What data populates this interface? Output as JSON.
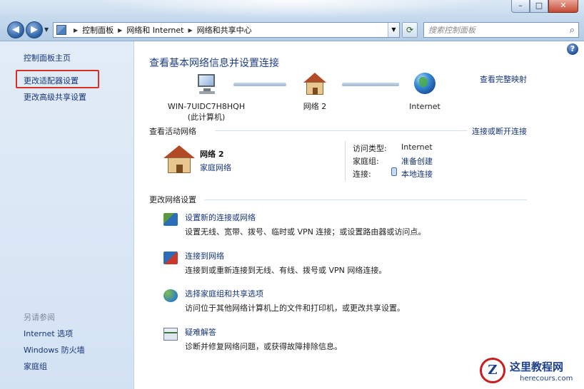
{
  "window": {
    "minimize": "–",
    "maximize": "□",
    "close": "✕"
  },
  "address": {
    "crumbs": [
      "控制面板",
      "网络和 Internet",
      "网络和共享中心"
    ]
  },
  "search": {
    "placeholder": "搜索控制面板"
  },
  "sidebar": {
    "home": "控制面板主页",
    "adapter": "更改适配器设置",
    "advanced": "更改高级共享设置",
    "see_also_header": "另请参阅",
    "see_also": [
      "Internet 选项",
      "Windows 防火墙",
      "家庭组"
    ]
  },
  "main": {
    "title": "查看基本网络信息并设置连接",
    "view_full_map": "查看完整映射",
    "map": {
      "pc_name": "WIN-7UIDC7H8HQH",
      "pc_sub": "(此计算机)",
      "network": "网络  2",
      "internet": "Internet"
    },
    "active_header": "查看活动网络",
    "connect_disconnect": "连接或断开连接",
    "active_network": {
      "name": "网络  2",
      "type": "家庭网络",
      "access_label": "访问类型:",
      "access_value": "Internet",
      "homegroup_label": "家庭组:",
      "homegroup_value": "准备创建",
      "connection_label": "连接:",
      "connection_value": "本地连接"
    },
    "change_header": "更改网络设置",
    "tasks": [
      {
        "link": "设置新的连接或网络",
        "desc": "设置无线、宽带、拨号、临时或 VPN 连接；或设置路由器或访问点。",
        "icon": "new-connection-icon"
      },
      {
        "link": "连接到网络",
        "desc": "连接到或重新连接到无线、有线、拨号或 VPN 网络连接。",
        "icon": "connect-network-icon"
      },
      {
        "link": "选择家庭组和共享选项",
        "desc": "访问位于其他网络计算机上的文件和打印机，或更改共享设置。",
        "icon": "homegroup-icon"
      },
      {
        "link": "疑难解答",
        "desc": "诊断并修复网络问题，或获得故障排除信息。",
        "icon": "troubleshoot-icon"
      }
    ]
  },
  "watermark": {
    "text": "这里教程网",
    "url": "herecours.com"
  }
}
